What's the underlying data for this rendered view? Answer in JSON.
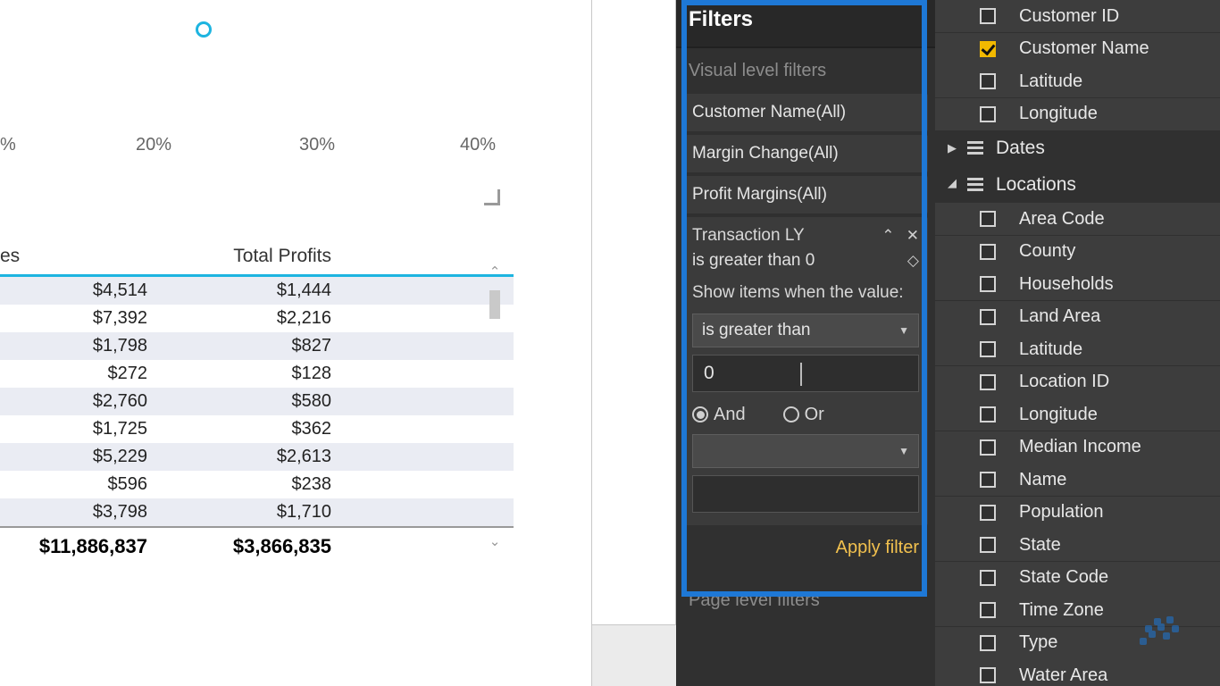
{
  "chart": {
    "ticks": [
      "%",
      "20%",
      "30%",
      "40%"
    ]
  },
  "table": {
    "headers": {
      "col_es": "es",
      "profits": "Total Profits"
    },
    "rows": [
      {
        "a": "$4,514",
        "b": "$1,444"
      },
      {
        "a": "$7,392",
        "b": "$2,216"
      },
      {
        "a": "$1,798",
        "b": "$827"
      },
      {
        "a": "$272",
        "b": "$128"
      },
      {
        "a": "$2,760",
        "b": "$580"
      },
      {
        "a": "$1,725",
        "b": "$362"
      },
      {
        "a": "$5,229",
        "b": "$2,613"
      },
      {
        "a": "$596",
        "b": "$238"
      },
      {
        "a": "$3,798",
        "b": "$1,710"
      }
    ],
    "totals": {
      "a": "$11,886,837",
      "b": "$3,866,835"
    }
  },
  "filters": {
    "title": "Filters",
    "visual_level_title": "Visual level filters",
    "cards": [
      "Customer Name(All)",
      "Margin Change(All)",
      "Profit Margins(All)"
    ],
    "active": {
      "name": "Transaction LY",
      "summary": "is greater than 0",
      "prompt": "Show items when the value:",
      "operator1": "is greater than",
      "value1": "0",
      "logic_and": "And",
      "logic_or": "Or",
      "operator2": "",
      "value2": ""
    },
    "apply": "Apply filter",
    "page_level_title": "Page level filters"
  },
  "fields": {
    "top_items": [
      {
        "label": "Customer ID",
        "checked": false
      },
      {
        "label": "Customer Name",
        "checked": true
      },
      {
        "label": "Latitude",
        "checked": false
      },
      {
        "label": "Longitude",
        "checked": false
      }
    ],
    "groups": [
      {
        "label": "Dates",
        "expanded": false
      },
      {
        "label": "Locations",
        "expanded": true
      }
    ],
    "location_items": [
      "Area Code",
      "County",
      "Households",
      "Land Area",
      "Latitude",
      "Location ID",
      "Longitude",
      "Median Income",
      "Name",
      "Population",
      "State",
      "State Code",
      "Time Zone",
      "Type",
      "Water Area"
    ]
  }
}
